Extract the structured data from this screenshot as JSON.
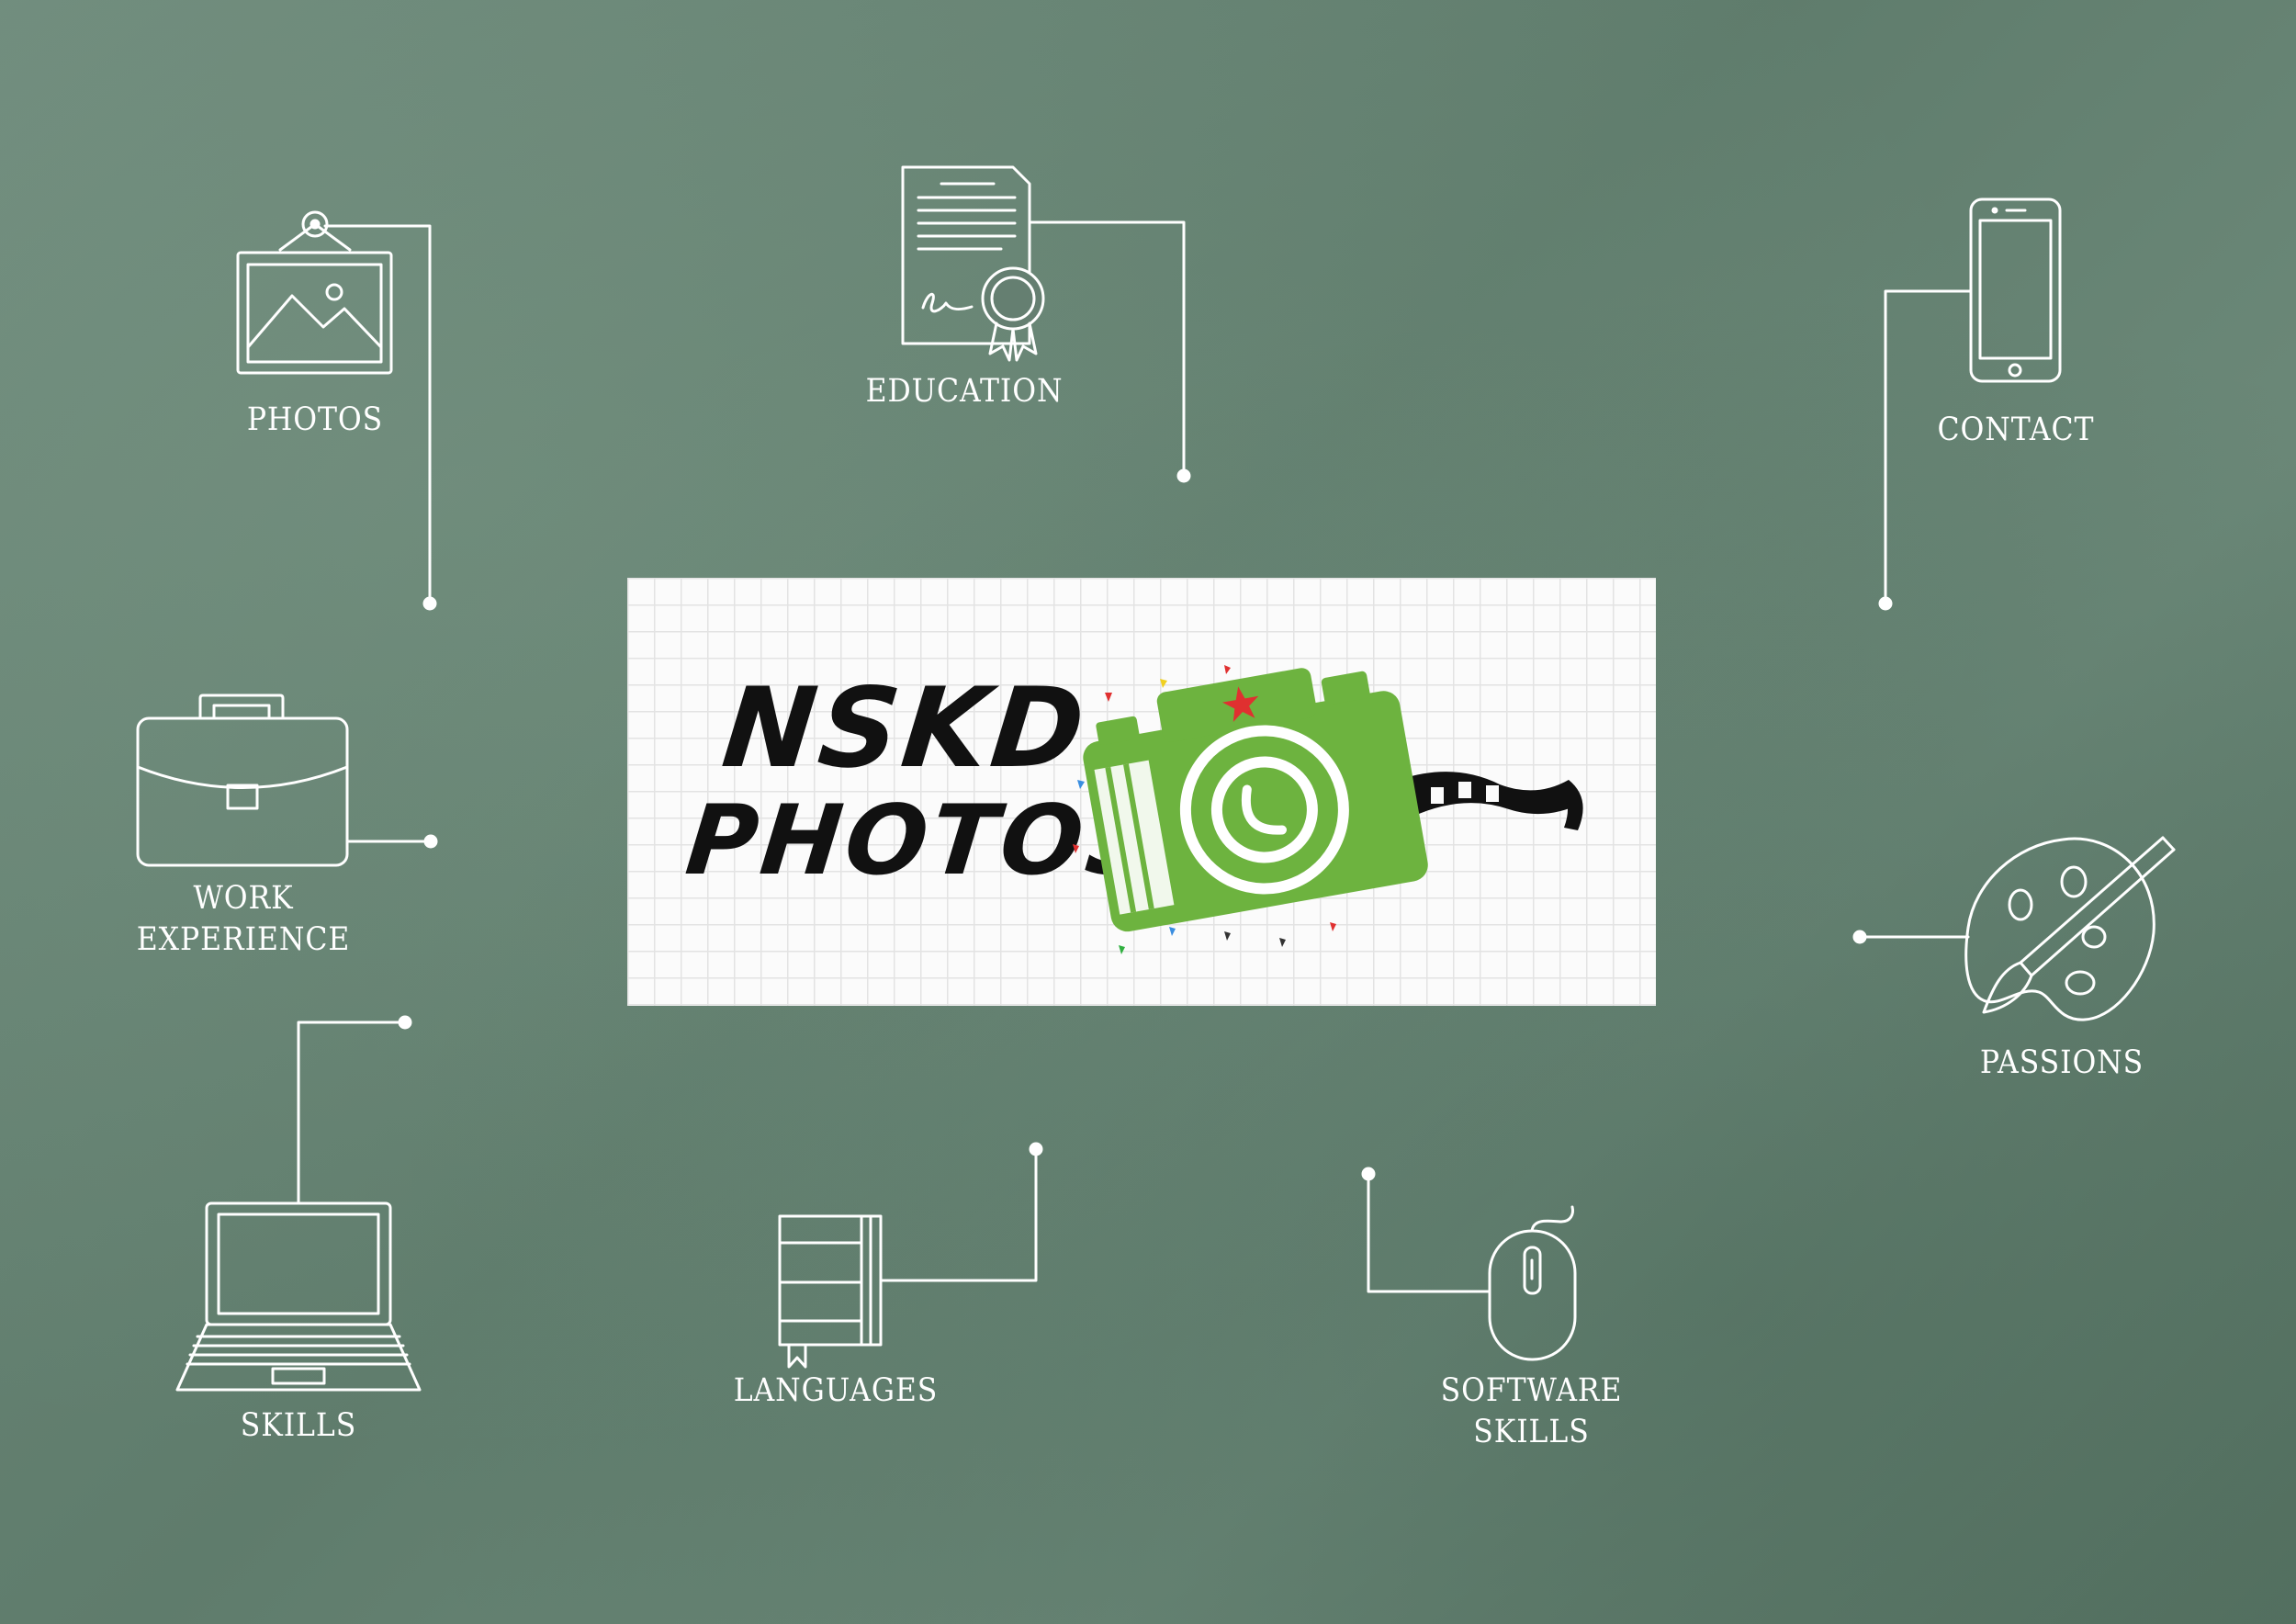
{
  "background_color": "#647f70",
  "line_color": "#ffffff",
  "logo": {
    "line1": "NSKD",
    "line2": "PHOTOS",
    "camera_color": "#6db33f",
    "card_color": "#fbfbfb"
  },
  "nodes": {
    "photos": {
      "label": "PHOTOS",
      "icon": "framed-picture-icon"
    },
    "education": {
      "label": "EDUCATION",
      "icon": "certificate-icon"
    },
    "contact": {
      "label": "CONTACT",
      "icon": "smartphone-icon"
    },
    "work_experience": {
      "label": "WORK\nEXPERIENCE",
      "icon": "briefcase-icon"
    },
    "passions": {
      "label": "PASSIONS",
      "icon": "palette-icon"
    },
    "skills": {
      "label": "SKILLS",
      "icon": "laptop-icon"
    },
    "languages": {
      "label": "LANGUAGES",
      "icon": "book-icon"
    },
    "software_skills": {
      "label": "SOFTWARE\nSKILLS",
      "icon": "mouse-icon"
    }
  }
}
